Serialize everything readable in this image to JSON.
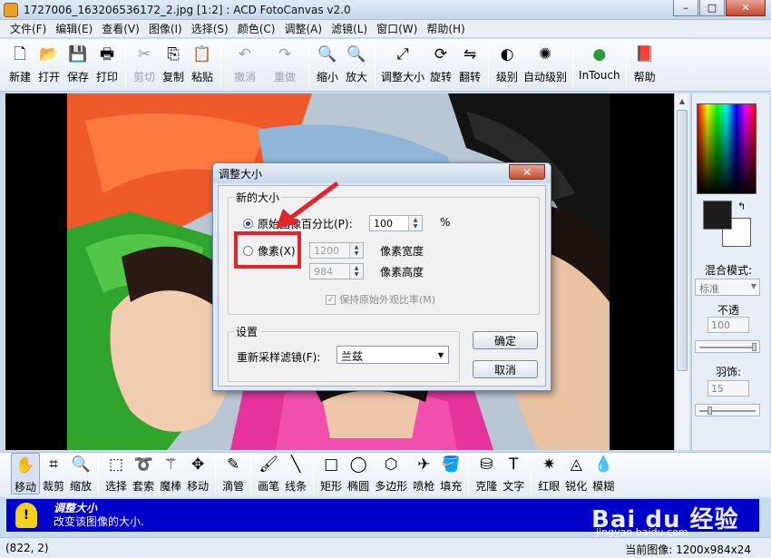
{
  "window": {
    "title": "1727006_163206536172_2.jpg [1:2] : ACD FotoCanvas v2.0",
    "min_label": "–",
    "max_label": "□",
    "close_label": "✕"
  },
  "menu": [
    "文件(F)",
    "编辑(E)",
    "查看(V)",
    "图像(I)",
    "选择(S)",
    "颜色(C)",
    "调整(A)",
    "滤镜(L)",
    "窗口(W)",
    "帮助(H)"
  ],
  "toolbar": {
    "new": {
      "label": "新建",
      "icon": "new-file-icon",
      "glyph": "🗋"
    },
    "open": {
      "label": "打开",
      "icon": "open-folder-icon",
      "glyph": "📂"
    },
    "save": {
      "label": "保存",
      "icon": "save-disk-icon",
      "glyph": "💾"
    },
    "print": {
      "label": "打印",
      "icon": "printer-icon",
      "glyph": "🖶"
    },
    "cut": {
      "label": "剪切",
      "icon": "scissors-icon",
      "glyph": "✂"
    },
    "copy": {
      "label": "复制",
      "icon": "copy-icon",
      "glyph": "⎘"
    },
    "paste": {
      "label": "粘贴",
      "icon": "paste-icon",
      "glyph": "📋"
    },
    "undo": {
      "label": "撤消",
      "icon": "undo-icon",
      "glyph": "↶"
    },
    "redo": {
      "label": "重做",
      "icon": "redo-icon",
      "glyph": "↷"
    },
    "zoom_out": {
      "label": "缩小",
      "icon": "zoom-out-icon",
      "glyph": "🔍"
    },
    "zoom_in": {
      "label": "放大",
      "icon": "zoom-in-icon",
      "glyph": "🔍"
    },
    "resize": {
      "label": "调整大小",
      "icon": "resize-icon",
      "glyph": "⤢"
    },
    "rotate": {
      "label": "旋转",
      "icon": "rotate-icon",
      "glyph": "⟳"
    },
    "flip": {
      "label": "翻转",
      "icon": "flip-icon",
      "glyph": "⇋"
    },
    "levels": {
      "label": "级别",
      "icon": "levels-icon",
      "glyph": "◐"
    },
    "auto_levels": {
      "label": "自动级别",
      "icon": "auto-levels-icon",
      "glyph": "✺"
    },
    "intouch": {
      "label": "InTouch",
      "icon": "intouch-icon",
      "glyph": "●"
    },
    "help": {
      "label": "帮助",
      "icon": "help-book-icon",
      "glyph": "📕"
    }
  },
  "tools": [
    {
      "label": "移动",
      "icon": "hand-icon",
      "glyph": "✋"
    },
    {
      "label": "裁剪",
      "icon": "crop-icon",
      "glyph": "⌗"
    },
    {
      "label": "缩放",
      "icon": "zoom-icon",
      "glyph": "🔍"
    },
    {
      "label": "选择",
      "icon": "rect-select-icon",
      "glyph": "⬚"
    },
    {
      "label": "套索",
      "icon": "lasso-icon",
      "glyph": "➰"
    },
    {
      "label": "魔棒",
      "icon": "magic-wand-icon",
      "glyph": "⚚"
    },
    {
      "label": "移动",
      "icon": "move-arrows-icon",
      "glyph": "✥"
    },
    {
      "label": "滴管",
      "icon": "eyedropper-icon",
      "glyph": "✎"
    },
    {
      "label": "画笔",
      "icon": "brush-icon",
      "glyph": "🖌"
    },
    {
      "label": "线条",
      "icon": "line-icon",
      "glyph": "╲"
    },
    {
      "label": "矩形",
      "icon": "rectangle-icon",
      "glyph": "□"
    },
    {
      "label": "椭圆",
      "icon": "ellipse-icon",
      "glyph": "◯"
    },
    {
      "label": "多边形",
      "icon": "polygon-icon",
      "glyph": "⬡"
    },
    {
      "label": "喷枪",
      "icon": "airbrush-icon",
      "glyph": "✈"
    },
    {
      "label": "填充",
      "icon": "fill-bucket-icon",
      "glyph": "🪣"
    },
    {
      "label": "克隆",
      "icon": "clone-stamp-icon",
      "glyph": "⛁"
    },
    {
      "label": "文字",
      "icon": "text-icon",
      "glyph": "T"
    },
    {
      "label": "红眼",
      "icon": "red-eye-icon",
      "glyph": "✷"
    },
    {
      "label": "锐化",
      "icon": "sharpen-icon",
      "glyph": "◬"
    },
    {
      "label": "模糊",
      "icon": "blur-drop-icon",
      "glyph": "💧"
    }
  ],
  "right_panel": {
    "blend_label": "混合模式:",
    "blend_value": "标准",
    "opacity_label": "不透",
    "opacity_value": "100",
    "feather_label": "羽饰:",
    "feather_value": "15",
    "opacity_level": 1.0,
    "feather_level": 0.15
  },
  "dialog": {
    "title": "调整大小",
    "close_label": "✕",
    "group_new_size": "新的大小",
    "radio_percent": "原始图像百分比(P):",
    "percent_value": "100",
    "percent_unit": "%",
    "radio_pixels": "像素(X)",
    "width_value": "1200",
    "width_label": "像素宽度",
    "height_value": "984",
    "height_label": "像素高度",
    "keep_ratio": "保持原始外观比率(M)",
    "group_settings": "设置",
    "filter_label": "重新采样滤镜(F):",
    "filter_value": "兰兹",
    "ok": "确定",
    "cancel": "取消",
    "selected_mode": "percent"
  },
  "hint": {
    "title": "调整大小",
    "desc": "改变该图像的大小."
  },
  "status": {
    "coords": "(822, 2)",
    "image_info": "当前图像: 1200x984x24"
  },
  "watermark": {
    "text": "Bai du 经验",
    "sub": "jingyan.baidu.com"
  },
  "colors": {
    "highlight": "#e0262c",
    "hint_bg": "#0000c8"
  }
}
